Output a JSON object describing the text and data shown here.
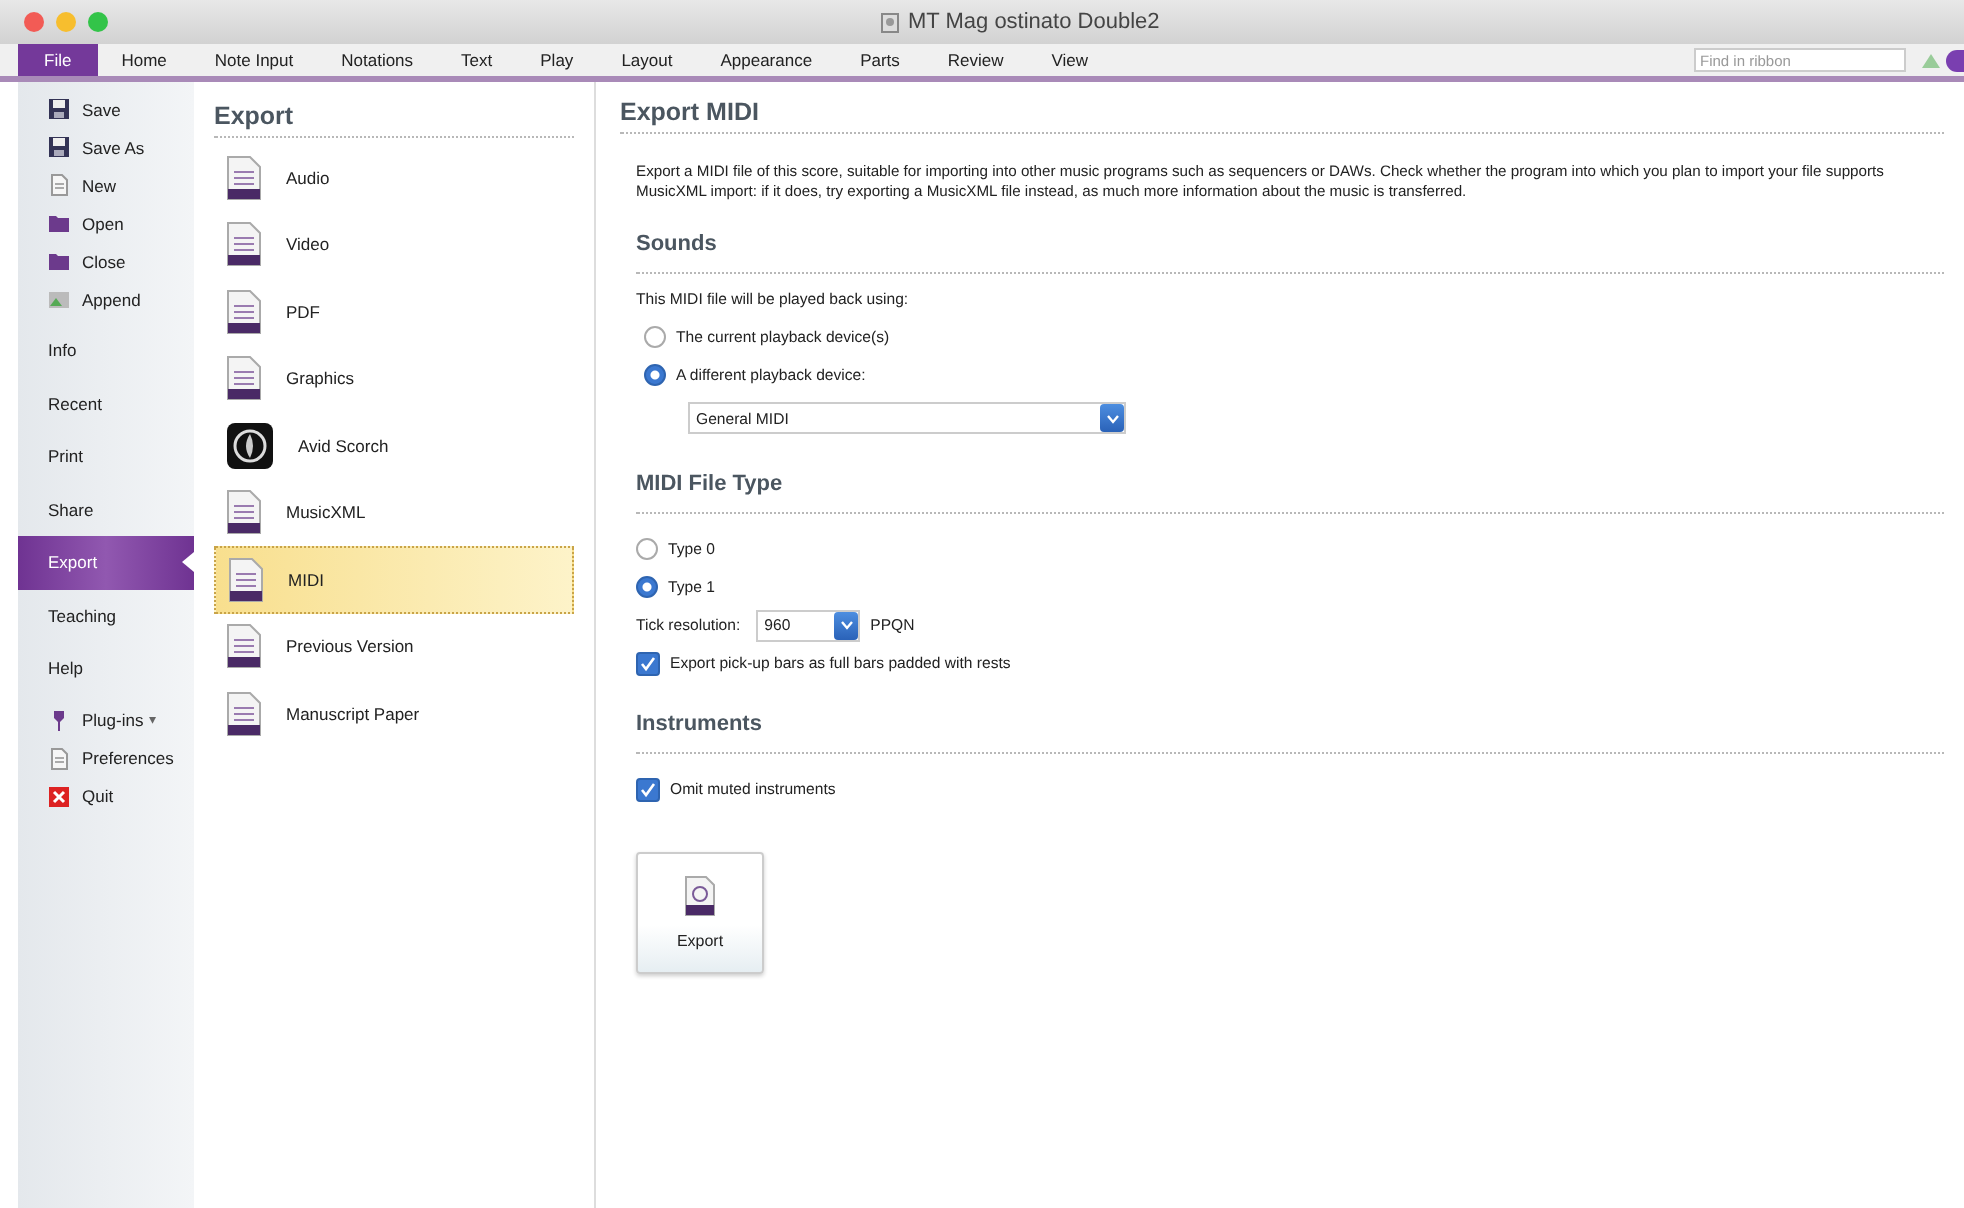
{
  "window": {
    "title": "MT Mag ostinato Double2"
  },
  "ribbon": {
    "tabs": [
      {
        "label": "File",
        "selected": true
      },
      {
        "label": "Home",
        "selected": false
      },
      {
        "label": "Note Input",
        "selected": false
      },
      {
        "label": "Notations",
        "selected": false
      },
      {
        "label": "Text",
        "selected": false
      },
      {
        "label": "Play",
        "selected": false
      },
      {
        "label": "Layout",
        "selected": false
      },
      {
        "label": "Appearance",
        "selected": false
      },
      {
        "label": "Parts",
        "selected": false
      },
      {
        "label": "Review",
        "selected": false
      },
      {
        "label": "View",
        "selected": false
      }
    ],
    "search": {
      "placeholder": "Find in ribbon"
    }
  },
  "sidebar": {
    "items": [
      {
        "kind": "command",
        "label": "Save",
        "selected": false
      },
      {
        "kind": "command",
        "label": "Save As",
        "selected": false
      },
      {
        "kind": "command",
        "label": "New",
        "selected": false
      },
      {
        "kind": "command",
        "label": "Open",
        "selected": false
      },
      {
        "kind": "command",
        "label": "Close",
        "selected": false
      },
      {
        "kind": "command",
        "label": "Append",
        "selected": false
      },
      {
        "kind": "section",
        "label": "Info",
        "selected": false
      },
      {
        "kind": "section",
        "label": "Recent",
        "selected": false
      },
      {
        "kind": "section",
        "label": "Print",
        "selected": false
      },
      {
        "kind": "section",
        "label": "Share",
        "selected": false
      },
      {
        "kind": "section",
        "label": "Export",
        "selected": true
      },
      {
        "kind": "section",
        "label": "Teaching",
        "selected": false
      },
      {
        "kind": "section",
        "label": "Help",
        "selected": false
      },
      {
        "kind": "menu",
        "label": "Plug-ins",
        "caret": "▾",
        "selected": false
      },
      {
        "kind": "command",
        "label": "Preferences",
        "selected": false
      },
      {
        "kind": "command",
        "label": "Quit",
        "selected": false
      }
    ]
  },
  "export_types": {
    "title": "Export",
    "items": [
      {
        "label": "Audio",
        "selected": false
      },
      {
        "label": "Video",
        "selected": false
      },
      {
        "label": "PDF",
        "selected": false
      },
      {
        "label": "Graphics",
        "selected": false
      },
      {
        "label": "Avid Scorch",
        "selected": false
      },
      {
        "label": "MusicXML",
        "selected": false
      },
      {
        "label": "MIDI",
        "selected": true
      },
      {
        "label": "Previous Version",
        "selected": false
      },
      {
        "label": "Manuscript Paper",
        "selected": false
      }
    ]
  },
  "panel": {
    "title": "Export MIDI",
    "description": "Export a MIDI file of this score, suitable for importing into other music programs such as sequencers or DAWs. Check whether the program into which you plan to import your file supports MusicXML import: if it does, try exporting a MusicXML file instead, as much more information about the music is transferred.",
    "sections": [
      {
        "title": "Sounds",
        "controls": [
          {
            "kind": "text",
            "text": "This MIDI file will be played back using:"
          },
          {
            "kind": "radio",
            "label": "The current playback device(s)",
            "selected": false
          },
          {
            "kind": "radio",
            "label": "A different playback device:",
            "selected": true
          },
          {
            "kind": "dropdown",
            "value": "General MIDI"
          }
        ]
      },
      {
        "title": "MIDI File Type",
        "controls": [
          {
            "kind": "radio",
            "label": "Type 0",
            "selected": false
          },
          {
            "kind": "radio",
            "label": "Type 1",
            "selected": true
          },
          {
            "kind": "spin",
            "label": "Tick resolution:",
            "value": "960",
            "unit": "PPQN"
          },
          {
            "kind": "checkbox",
            "label": "Export pick-up bars as full bars padded with rests",
            "checked": true
          }
        ]
      },
      {
        "title": "Instruments",
        "controls": [
          {
            "kind": "checkbox",
            "label": "Omit muted instruments",
            "checked": true
          }
        ]
      }
    ],
    "export_button": {
      "label": "Export"
    }
  }
}
